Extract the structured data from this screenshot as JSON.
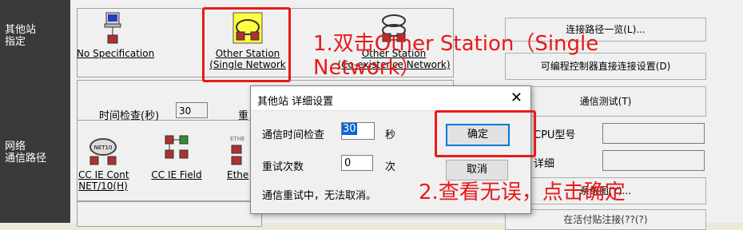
{
  "left_labels": {
    "other_station": "其他站\n指定",
    "network_route": "网络\n通信路径"
  },
  "top_icons": [
    {
      "label": "No Specification"
    },
    {
      "label": "Other Station\n(Single Network"
    },
    {
      "label": "Other Station\n(Co-existence Network)"
    }
  ],
  "net_icons": [
    {
      "label": "CC IE Cont\nNET/10(H)"
    },
    {
      "label": "CC IE Field"
    },
    {
      "label": "Ethe"
    }
  ],
  "right_buttons": {
    "connection_list": "连接路径一览(L)...",
    "plc_direct": "可编程控制器直接连接设置(D)",
    "comm_test": "通信测试(T)",
    "system_view": "系统图(Y)...",
    "bottom_partial": "在活付贴注接(??(?)"
  },
  "right_fields": {
    "cpu_type": "CPU型号",
    "detail": "详细"
  },
  "background_form": {
    "time_check_label": "时间检查(秒)",
    "time_check_value": "30",
    "retry_partial": "重"
  },
  "dialog": {
    "title": "其他站 详细设置",
    "close": "✕",
    "time_check_label": "通信时间检查",
    "time_check_value": "30",
    "time_unit": "秒",
    "retry_label": "重试次数",
    "retry_value": "0",
    "retry_unit": "次",
    "note": "通信重试中，无法取消。",
    "ok": "确定",
    "cancel": "取消"
  },
  "annotations": {
    "step1": "1.双击Other Station（Single\nNetwork）",
    "step2": "2.查看无误，点击确定"
  },
  "colors": {
    "annotation": "#e81a1a",
    "sidebar": "#3a3a3a",
    "selection": "#0a64d8"
  }
}
